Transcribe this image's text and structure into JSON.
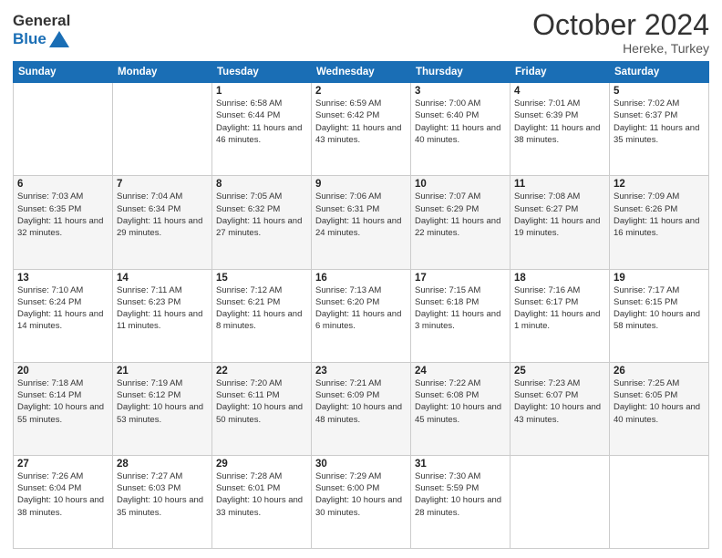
{
  "header": {
    "logo_general": "General",
    "logo_blue": "Blue",
    "month_title": "October 2024",
    "location": "Hereke, Turkey"
  },
  "weekdays": [
    "Sunday",
    "Monday",
    "Tuesday",
    "Wednesday",
    "Thursday",
    "Friday",
    "Saturday"
  ],
  "weeks": [
    [
      null,
      null,
      {
        "day": "1",
        "sunrise": "6:58 AM",
        "sunset": "6:44 PM",
        "daylight": "11 hours and 46 minutes."
      },
      {
        "day": "2",
        "sunrise": "6:59 AM",
        "sunset": "6:42 PM",
        "daylight": "11 hours and 43 minutes."
      },
      {
        "day": "3",
        "sunrise": "7:00 AM",
        "sunset": "6:40 PM",
        "daylight": "11 hours and 40 minutes."
      },
      {
        "day": "4",
        "sunrise": "7:01 AM",
        "sunset": "6:39 PM",
        "daylight": "11 hours and 38 minutes."
      },
      {
        "day": "5",
        "sunrise": "7:02 AM",
        "sunset": "6:37 PM",
        "daylight": "11 hours and 35 minutes."
      }
    ],
    [
      {
        "day": "6",
        "sunrise": "7:03 AM",
        "sunset": "6:35 PM",
        "daylight": "11 hours and 32 minutes."
      },
      {
        "day": "7",
        "sunrise": "7:04 AM",
        "sunset": "6:34 PM",
        "daylight": "11 hours and 29 minutes."
      },
      {
        "day": "8",
        "sunrise": "7:05 AM",
        "sunset": "6:32 PM",
        "daylight": "11 hours and 27 minutes."
      },
      {
        "day": "9",
        "sunrise": "7:06 AM",
        "sunset": "6:31 PM",
        "daylight": "11 hours and 24 minutes."
      },
      {
        "day": "10",
        "sunrise": "7:07 AM",
        "sunset": "6:29 PM",
        "daylight": "11 hours and 22 minutes."
      },
      {
        "day": "11",
        "sunrise": "7:08 AM",
        "sunset": "6:27 PM",
        "daylight": "11 hours and 19 minutes."
      },
      {
        "day": "12",
        "sunrise": "7:09 AM",
        "sunset": "6:26 PM",
        "daylight": "11 hours and 16 minutes."
      }
    ],
    [
      {
        "day": "13",
        "sunrise": "7:10 AM",
        "sunset": "6:24 PM",
        "daylight": "11 hours and 14 minutes."
      },
      {
        "day": "14",
        "sunrise": "7:11 AM",
        "sunset": "6:23 PM",
        "daylight": "11 hours and 11 minutes."
      },
      {
        "day": "15",
        "sunrise": "7:12 AM",
        "sunset": "6:21 PM",
        "daylight": "11 hours and 8 minutes."
      },
      {
        "day": "16",
        "sunrise": "7:13 AM",
        "sunset": "6:20 PM",
        "daylight": "11 hours and 6 minutes."
      },
      {
        "day": "17",
        "sunrise": "7:15 AM",
        "sunset": "6:18 PM",
        "daylight": "11 hours and 3 minutes."
      },
      {
        "day": "18",
        "sunrise": "7:16 AM",
        "sunset": "6:17 PM",
        "daylight": "11 hours and 1 minute."
      },
      {
        "day": "19",
        "sunrise": "7:17 AM",
        "sunset": "6:15 PM",
        "daylight": "10 hours and 58 minutes."
      }
    ],
    [
      {
        "day": "20",
        "sunrise": "7:18 AM",
        "sunset": "6:14 PM",
        "daylight": "10 hours and 55 minutes."
      },
      {
        "day": "21",
        "sunrise": "7:19 AM",
        "sunset": "6:12 PM",
        "daylight": "10 hours and 53 minutes."
      },
      {
        "day": "22",
        "sunrise": "7:20 AM",
        "sunset": "6:11 PM",
        "daylight": "10 hours and 50 minutes."
      },
      {
        "day": "23",
        "sunrise": "7:21 AM",
        "sunset": "6:09 PM",
        "daylight": "10 hours and 48 minutes."
      },
      {
        "day": "24",
        "sunrise": "7:22 AM",
        "sunset": "6:08 PM",
        "daylight": "10 hours and 45 minutes."
      },
      {
        "day": "25",
        "sunrise": "7:23 AM",
        "sunset": "6:07 PM",
        "daylight": "10 hours and 43 minutes."
      },
      {
        "day": "26",
        "sunrise": "7:25 AM",
        "sunset": "6:05 PM",
        "daylight": "10 hours and 40 minutes."
      }
    ],
    [
      {
        "day": "27",
        "sunrise": "7:26 AM",
        "sunset": "6:04 PM",
        "daylight": "10 hours and 38 minutes."
      },
      {
        "day": "28",
        "sunrise": "7:27 AM",
        "sunset": "6:03 PM",
        "daylight": "10 hours and 35 minutes."
      },
      {
        "day": "29",
        "sunrise": "7:28 AM",
        "sunset": "6:01 PM",
        "daylight": "10 hours and 33 minutes."
      },
      {
        "day": "30",
        "sunrise": "7:29 AM",
        "sunset": "6:00 PM",
        "daylight": "10 hours and 30 minutes."
      },
      {
        "day": "31",
        "sunrise": "7:30 AM",
        "sunset": "5:59 PM",
        "daylight": "10 hours and 28 minutes."
      },
      null,
      null
    ]
  ]
}
